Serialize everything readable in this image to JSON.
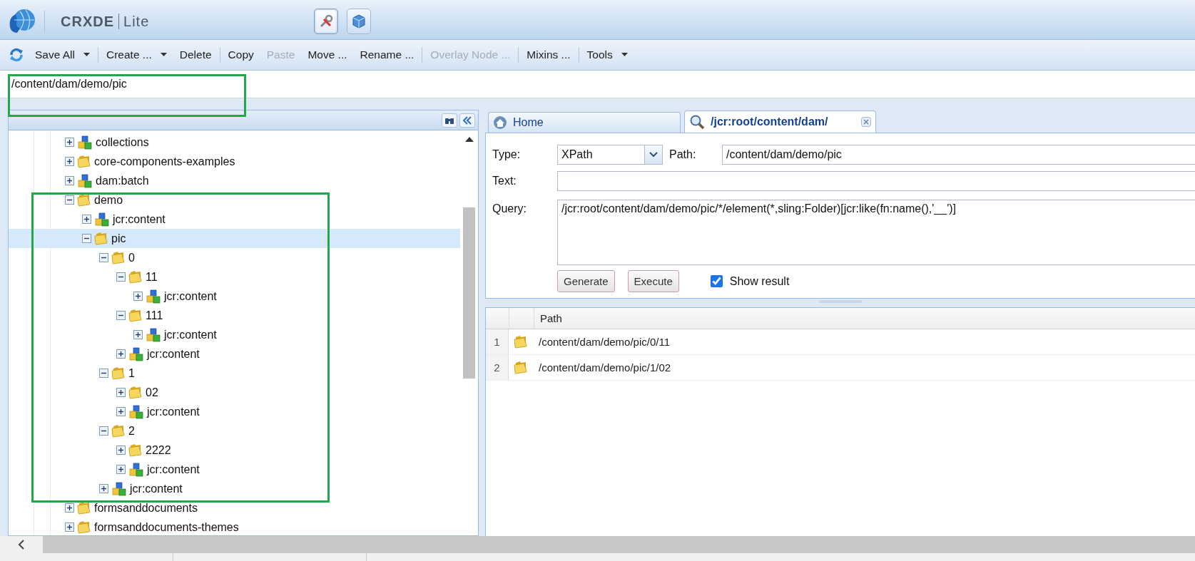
{
  "header": {
    "product": "CRXDE",
    "edition": "Lite",
    "tools": [
      {
        "kind": "wrench",
        "selected": true
      },
      {
        "kind": "package",
        "selected": false
      }
    ]
  },
  "toolbar": {
    "groups": [
      [
        {
          "label": "Save All",
          "dropdown": true,
          "disabled": false
        }
      ],
      [
        {
          "label": "Create ...",
          "dropdown": true,
          "disabled": false
        },
        {
          "label": "Delete",
          "dropdown": false,
          "disabled": false
        }
      ],
      [
        {
          "label": "Copy",
          "dropdown": false,
          "disabled": false
        },
        {
          "label": "Paste",
          "dropdown": false,
          "disabled": true
        },
        {
          "label": "Move ...",
          "dropdown": false,
          "disabled": false
        },
        {
          "label": "Rename ...",
          "dropdown": false,
          "disabled": false
        }
      ],
      [
        {
          "label": "Overlay Node ...",
          "dropdown": false,
          "disabled": true
        }
      ],
      [
        {
          "label": "Mixins ...",
          "dropdown": false,
          "disabled": false
        }
      ],
      [
        {
          "label": "Tools",
          "dropdown": true,
          "disabled": false
        }
      ]
    ]
  },
  "address": {
    "value": "/content/dam/demo/pic"
  },
  "tree": {
    "items": [
      {
        "label": "collections",
        "kind": "node",
        "expanded": false,
        "selected": false
      },
      {
        "label": "core-components-examples",
        "kind": "folder",
        "expanded": false,
        "selected": false
      },
      {
        "label": "dam:batch",
        "kind": "node",
        "expanded": false,
        "selected": false
      },
      {
        "label": "demo",
        "kind": "folder",
        "expanded": true,
        "selected": false,
        "children": [
          {
            "label": "jcr:content",
            "kind": "node",
            "expanded": false,
            "selected": false
          },
          {
            "label": "pic",
            "kind": "folder",
            "expanded": true,
            "selected": true,
            "children": [
              {
                "label": "0",
                "kind": "folder",
                "expanded": true,
                "selected": false,
                "children": [
                  {
                    "label": "11",
                    "kind": "folder",
                    "expanded": true,
                    "selected": false,
                    "children": [
                      {
                        "label": "jcr:content",
                        "kind": "node",
                        "expanded": false,
                        "selected": false
                      }
                    ]
                  },
                  {
                    "label": "111",
                    "kind": "folder",
                    "expanded": true,
                    "selected": false,
                    "children": [
                      {
                        "label": "jcr:content",
                        "kind": "node",
                        "expanded": false,
                        "selected": false
                      }
                    ]
                  },
                  {
                    "label": "jcr:content",
                    "kind": "node",
                    "expanded": false,
                    "selected": false
                  }
                ]
              },
              {
                "label": "1",
                "kind": "folder",
                "expanded": true,
                "selected": false,
                "children": [
                  {
                    "label": "02",
                    "kind": "folder",
                    "expanded": false,
                    "selected": false
                  },
                  {
                    "label": "jcr:content",
                    "kind": "node",
                    "expanded": false,
                    "selected": false
                  }
                ]
              },
              {
                "label": "2",
                "kind": "folder",
                "expanded": true,
                "selected": false,
                "children": [
                  {
                    "label": "2222",
                    "kind": "folder",
                    "expanded": false,
                    "selected": false
                  },
                  {
                    "label": "jcr:content",
                    "kind": "node",
                    "expanded": false,
                    "selected": false
                  }
                ]
              },
              {
                "label": "jcr:content",
                "kind": "node",
                "expanded": false,
                "selected": false
              }
            ]
          }
        ]
      },
      {
        "label": "formsanddocuments",
        "kind": "folder",
        "expanded": false,
        "selected": false
      },
      {
        "label": "formsanddocuments-themes",
        "kind": "folder",
        "expanded": false,
        "selected": false
      }
    ]
  },
  "tabs": [
    {
      "label": "Home",
      "kind": "home",
      "selected": false,
      "closable": false
    },
    {
      "label": "/jcr:root/content/dam/",
      "kind": "search",
      "selected": true,
      "closable": true
    }
  ],
  "query": {
    "type_label": "Type:",
    "type_value": "XPath",
    "path_label": "Path:",
    "path_value": "/content/dam/demo/pic",
    "text_label": "Text:",
    "query_label": "Query:",
    "query_value": "/jcr:root/content/dam/demo/pic/*/element(*,sling:Folder)[jcr:like(fn:name(),'__')]",
    "buttons": [
      "Generate",
      "Execute"
    ],
    "show_result": {
      "label": "Show result",
      "checked": true
    }
  },
  "results": {
    "path_heading": "Path",
    "rows": [
      {
        "number": "1",
        "kind": "folder",
        "path": "/content/dam/demo/pic/0/11"
      },
      {
        "number": "2",
        "kind": "folder",
        "path": "/content/dam/demo/pic/1/02"
      }
    ]
  }
}
